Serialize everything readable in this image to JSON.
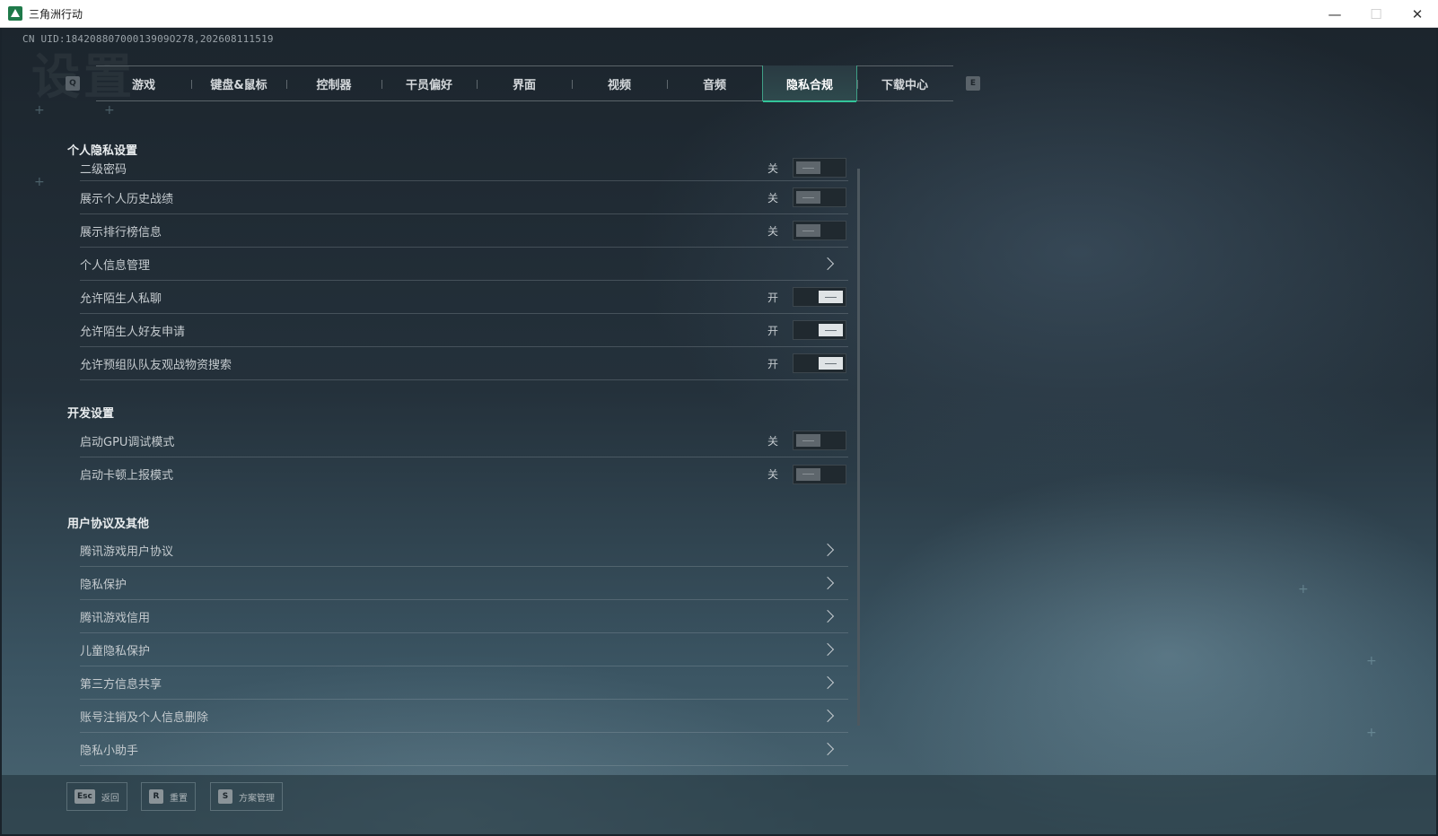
{
  "window": {
    "title": "三角洲行动",
    "minimize_glyph": "—",
    "maximize_glyph": "☐",
    "close_glyph": "✕"
  },
  "uid": "CN UID:18420880700013909O278,202608111519",
  "watermark": "设置",
  "tabs": {
    "prev_key": "Q",
    "next_key": "E",
    "items": [
      "游戏",
      "键盘&鼠标",
      "控制器",
      "干员偏好",
      "界面",
      "视频",
      "音频",
      "隐私合规",
      "下载中心"
    ],
    "active": "隐私合规"
  },
  "sections": {
    "privacy": {
      "title": "个人隐私设置",
      "rows": [
        {
          "label": "二级密码",
          "state": "关"
        },
        {
          "label": "展示个人历史战绩",
          "state": "关"
        },
        {
          "label": "展示排行榜信息",
          "state": "关"
        },
        {
          "label": "个人信息管理"
        },
        {
          "label": "允许陌生人私聊",
          "state": "开"
        },
        {
          "label": "允许陌生人好友申请",
          "state": "开"
        },
        {
          "label": "允许预组队队友观战物资搜索",
          "state": "开"
        }
      ]
    },
    "dev": {
      "title": "开发设置",
      "rows": [
        {
          "label": "启动GPU调试模式",
          "state": "关"
        },
        {
          "label": "启动卡顿上报模式",
          "state": "关"
        }
      ]
    },
    "agreements": {
      "title": "用户协议及其他",
      "rows": [
        {
          "label": "腾讯游戏用户协议"
        },
        {
          "label": "隐私保护"
        },
        {
          "label": "腾讯游戏信用"
        },
        {
          "label": "儿童隐私保护"
        },
        {
          "label": "第三方信息共享"
        },
        {
          "label": "账号注销及个人信息删除"
        },
        {
          "label": "隐私小助手"
        }
      ]
    }
  },
  "bottom_hints": [
    {
      "key": "Esc",
      "label": "返回"
    },
    {
      "key": "R",
      "label": "重置"
    },
    {
      "key": "S",
      "label": "方案管理"
    }
  ],
  "colors": {
    "accent": "#33c49a",
    "toggle_on": "#dfe3e5",
    "toggle_off": "#5e666c"
  }
}
